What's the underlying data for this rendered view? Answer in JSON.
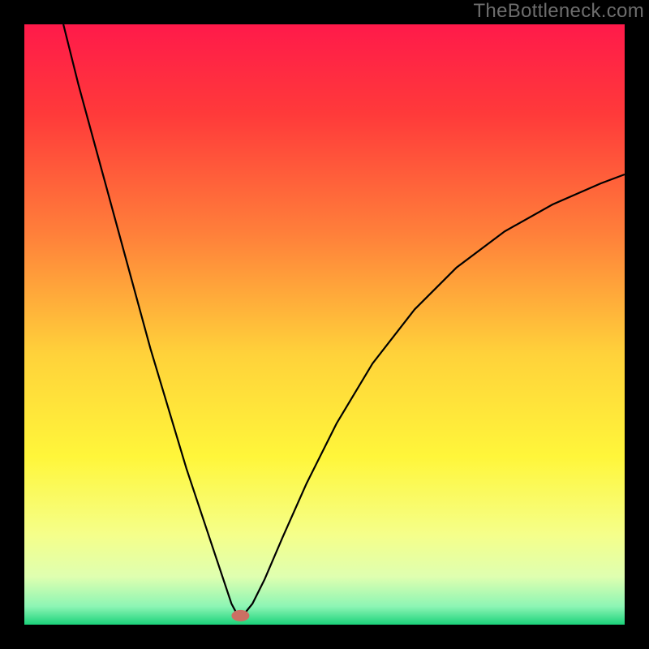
{
  "watermark": "TheBottleneck.com",
  "chart_data": {
    "type": "line",
    "title": "",
    "xlabel": "",
    "ylabel": "",
    "xlim": [
      0,
      100
    ],
    "ylim": [
      0,
      100
    ],
    "grid": false,
    "background_gradient": [
      {
        "pos": 0.0,
        "color": "#ff1a4a"
      },
      {
        "pos": 0.15,
        "color": "#ff3a3a"
      },
      {
        "pos": 0.35,
        "color": "#ff803a"
      },
      {
        "pos": 0.55,
        "color": "#ffd23a"
      },
      {
        "pos": 0.72,
        "color": "#fff63a"
      },
      {
        "pos": 0.85,
        "color": "#f5ff8a"
      },
      {
        "pos": 0.92,
        "color": "#dfffb0"
      },
      {
        "pos": 0.97,
        "color": "#8cf5b4"
      },
      {
        "pos": 1.0,
        "color": "#1bd27a"
      }
    ],
    "curve_points": [
      {
        "x": 6.5,
        "y": 100.0
      },
      {
        "x": 9.0,
        "y": 90.0
      },
      {
        "x": 12.0,
        "y": 79.0
      },
      {
        "x": 15.0,
        "y": 68.0
      },
      {
        "x": 18.0,
        "y": 57.0
      },
      {
        "x": 21.0,
        "y": 46.0
      },
      {
        "x": 24.0,
        "y": 36.0
      },
      {
        "x": 27.0,
        "y": 26.0
      },
      {
        "x": 30.0,
        "y": 17.0
      },
      {
        "x": 32.0,
        "y": 11.0
      },
      {
        "x": 33.5,
        "y": 6.5
      },
      {
        "x": 34.5,
        "y": 3.5
      },
      {
        "x": 35.3,
        "y": 2.0
      },
      {
        "x": 36.0,
        "y": 1.5
      },
      {
        "x": 36.8,
        "y": 2.0
      },
      {
        "x": 38.0,
        "y": 3.5
      },
      {
        "x": 40.0,
        "y": 7.5
      },
      {
        "x": 43.0,
        "y": 14.5
      },
      {
        "x": 47.0,
        "y": 23.5
      },
      {
        "x": 52.0,
        "y": 33.5
      },
      {
        "x": 58.0,
        "y": 43.5
      },
      {
        "x": 65.0,
        "y": 52.5
      },
      {
        "x": 72.0,
        "y": 59.5
      },
      {
        "x": 80.0,
        "y": 65.5
      },
      {
        "x": 88.0,
        "y": 70.0
      },
      {
        "x": 96.0,
        "y": 73.5
      },
      {
        "x": 100.0,
        "y": 75.0
      }
    ],
    "marker": {
      "x": 36.0,
      "y": 1.5,
      "color": "#cc6f63"
    },
    "border": {
      "color": "#000000",
      "thickness": 30
    }
  }
}
